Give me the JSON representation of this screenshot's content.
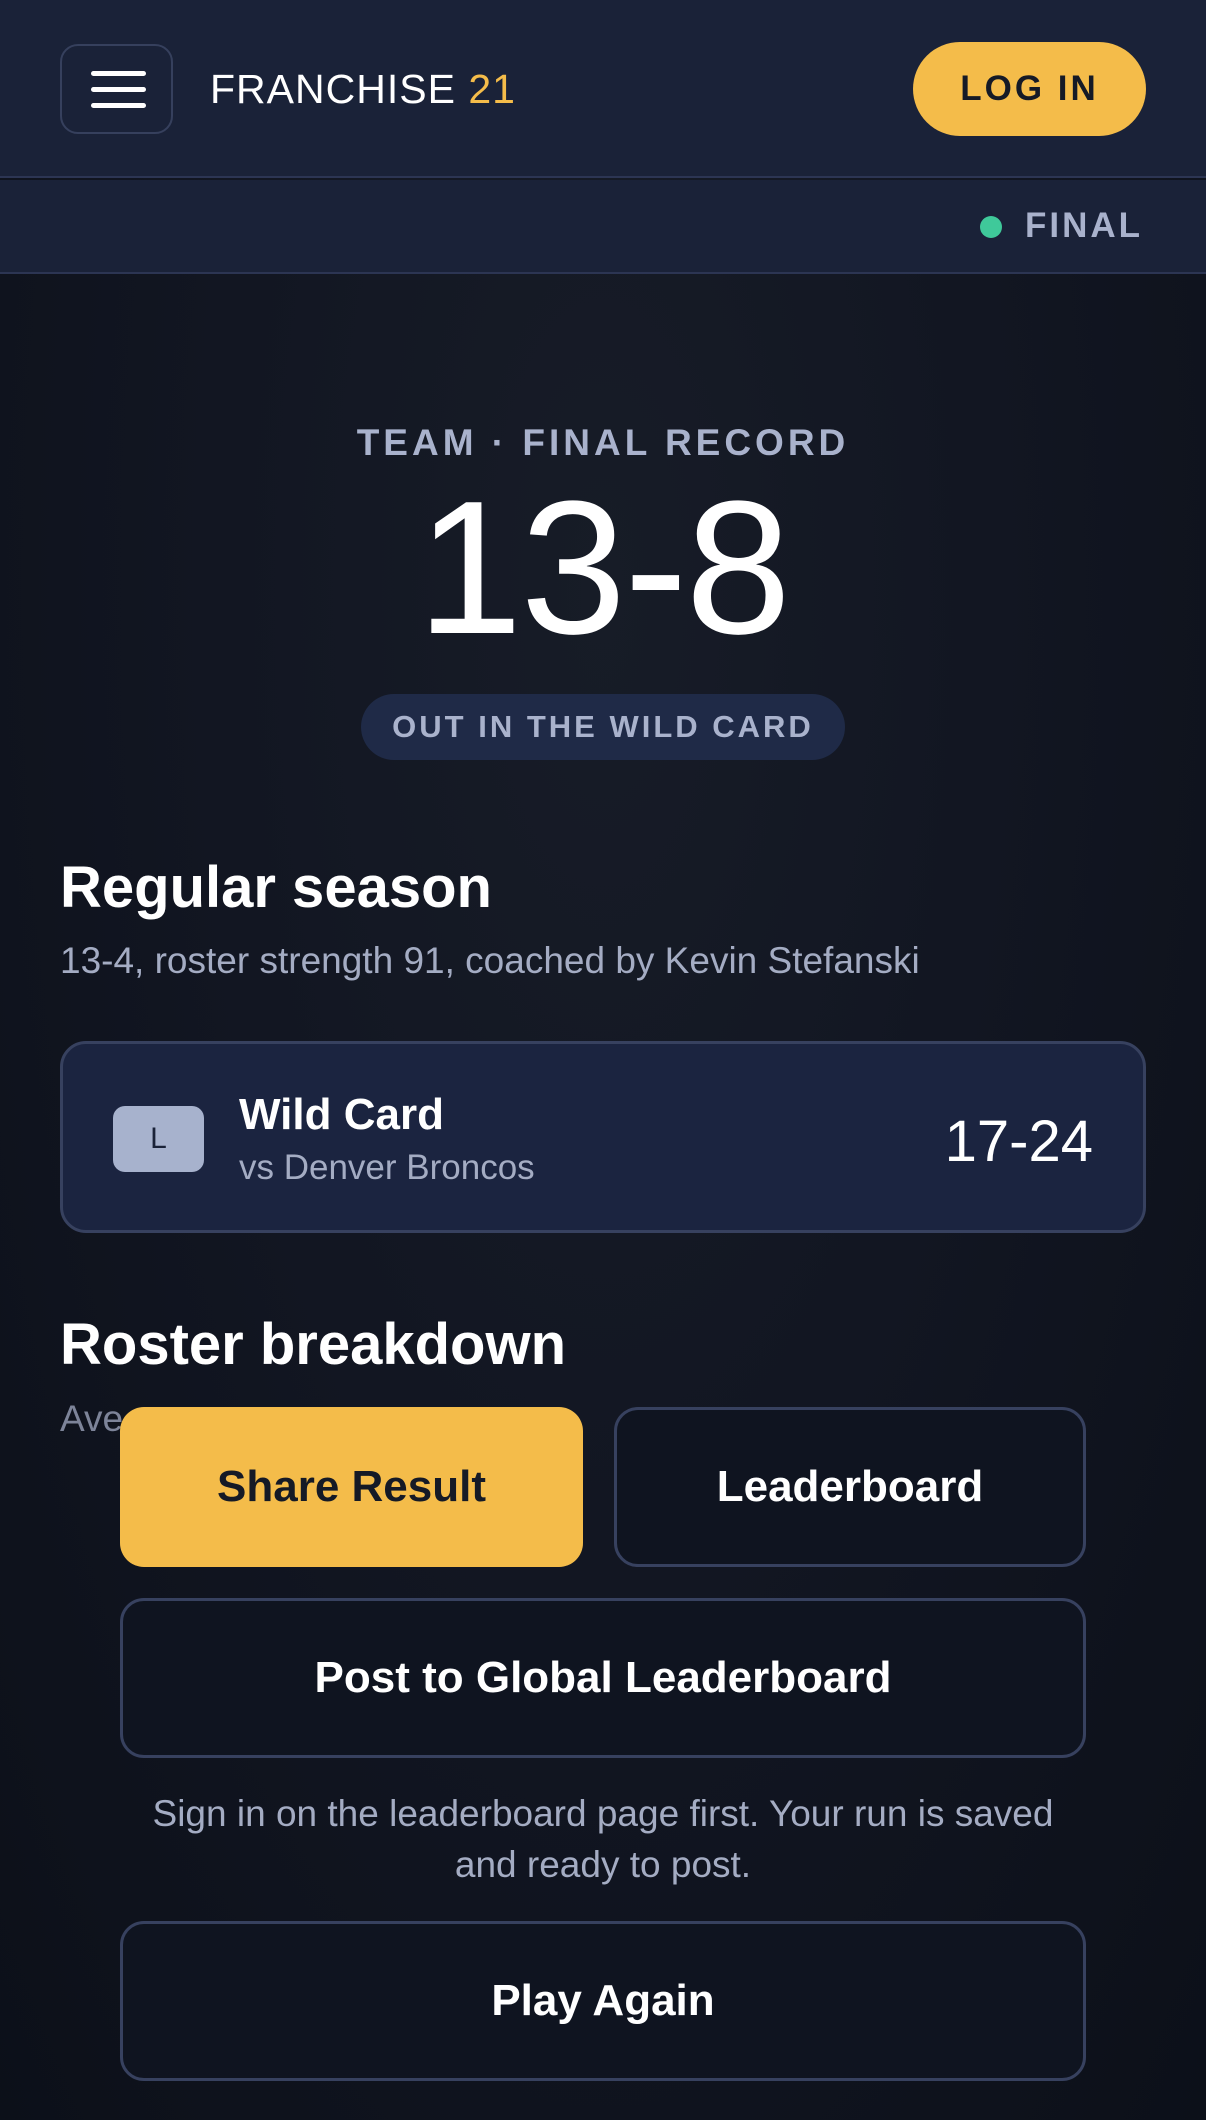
{
  "header": {
    "brand_name": "FRANCHISE",
    "brand_number": "21",
    "login_label": "LOG IN",
    "menu_icon": "hamburger-menu-icon"
  },
  "status": {
    "label": "FINAL",
    "dot_color": "#3fc99a"
  },
  "hero": {
    "eyebrow": "TEAM · FINAL RECORD",
    "record": "13-8",
    "outcome": "OUT IN THE WILD CARD"
  },
  "regular_season": {
    "title": "Regular season",
    "summary": "13-4, roster strength 91, coached by Kevin Stefanski"
  },
  "playoff_game": {
    "result": "L",
    "round": "Wild Card",
    "opponent": "vs Denver Broncos",
    "score": "17-24"
  },
  "roster": {
    "title": "Roster breakdown",
    "subtitle": "Ave"
  },
  "actions": {
    "share_label": "Share Result",
    "leaderboard_label": "Leaderboard",
    "post_label": "Post to Global Leaderboard",
    "note": "Sign in on the leaderboard page first. Your run is saved and ready to post.",
    "play_again_label": "Play Again"
  },
  "colors": {
    "accent": "#f4bc4a",
    "background": "#0f131d",
    "surface": "#1a2238",
    "border": "#37415f",
    "muted_text": "#a9b2cc"
  }
}
